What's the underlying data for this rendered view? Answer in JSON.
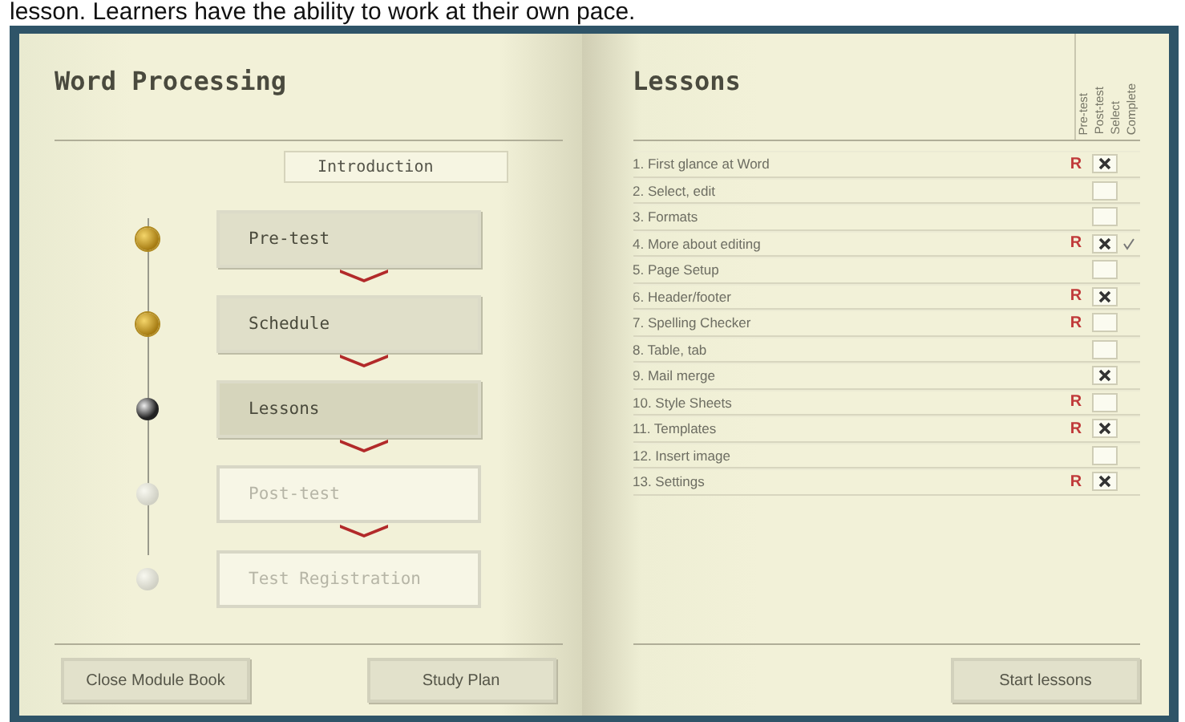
{
  "caption": "lesson. Learners have the ability to work at their own pace.",
  "module": {
    "title": "Word Processing",
    "intro": "Introduction",
    "steps": [
      {
        "label": "Pre-test",
        "completed": true,
        "selected": false,
        "disabled": false
      },
      {
        "label": "Schedule",
        "completed": true,
        "selected": false,
        "disabled": false
      },
      {
        "label": "Lessons",
        "completed": false,
        "selected": true,
        "disabled": false
      },
      {
        "label": "Post-test",
        "completed": false,
        "selected": false,
        "disabled": true
      },
      {
        "label": "Test Registration",
        "completed": false,
        "selected": false,
        "disabled": true
      }
    ],
    "buttons": [
      "Close Module Book",
      "Study Plan"
    ]
  },
  "lessons": {
    "title": "Lessons",
    "columns": [
      "Pre-test",
      "Post-test",
      "Select",
      "Complete"
    ],
    "rows": [
      {
        "name": "1. First glance at Word",
        "pre_test": "R",
        "checked": true,
        "complete": false
      },
      {
        "name": "2. Select, edit",
        "checked": false,
        "complete": false
      },
      {
        "name": "3. Formats",
        "checked": false,
        "complete": false
      },
      {
        "name": "4. More about editing",
        "pre_test": "R",
        "checked": true,
        "complete": true
      },
      {
        "name": "5. Page Setup",
        "checked": false,
        "complete": false
      },
      {
        "name": "6. Header/footer",
        "pre_test": "R",
        "checked": true,
        "complete": false
      },
      {
        "name": "7. Spelling Checker",
        "pre_test": "R",
        "checked": false,
        "complete": false
      },
      {
        "name": "8. Table, tab",
        "checked": false,
        "complete": false
      },
      {
        "name": "9. Mail merge",
        "checked": true,
        "complete": false
      },
      {
        "name": "10. Style Sheets",
        "pre_test": "R",
        "checked": false,
        "complete": false
      },
      {
        "name": "11. Templates",
        "pre_test": "R",
        "checked": true,
        "complete": false
      },
      {
        "name": "12. Insert image",
        "checked": false,
        "complete": false
      },
      {
        "name": "13. Settings",
        "pre_test": "R",
        "checked": true,
        "complete": false
      }
    ],
    "button": "Start lessons"
  }
}
